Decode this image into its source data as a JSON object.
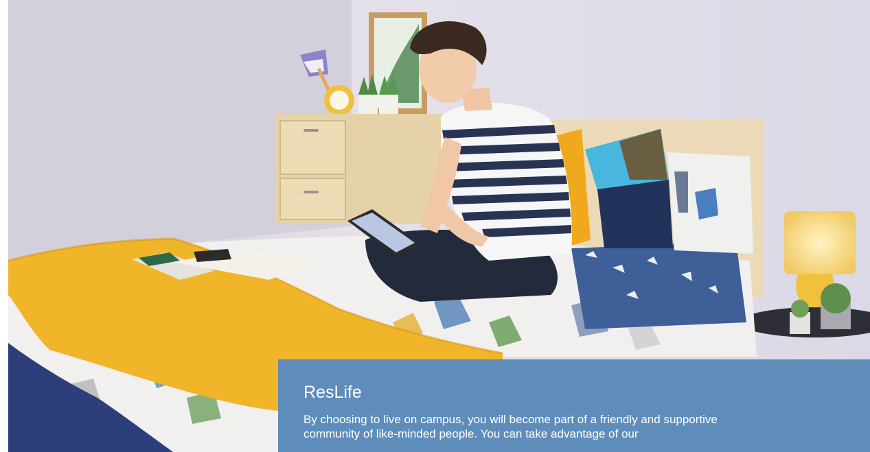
{
  "hero": {
    "image_icon": "dorm-room-photo",
    "colors": {
      "wall": "#e6e3ee",
      "wall_side": "#d9d6e3",
      "throw": "#f1b52a",
      "cushion_teal": "#4fb4d8",
      "cushion_navy": "#22325a",
      "desk": "#e9d8b8"
    }
  },
  "card": {
    "title": "ResLife",
    "body": "By choosing to live on campus, you will become part of a friendly and supportive community of like-minded people. You can take advantage of our",
    "background": "#5e8dbb"
  }
}
